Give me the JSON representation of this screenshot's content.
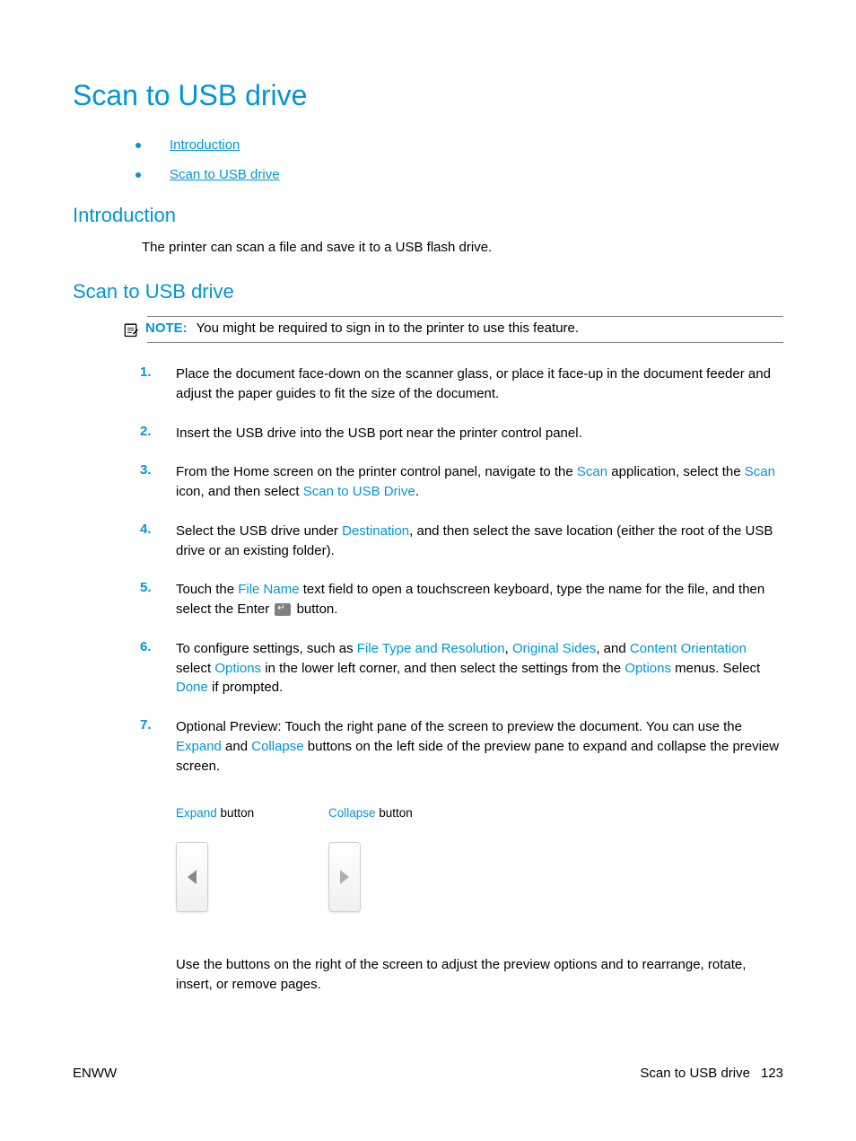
{
  "page_title": "Scan to USB drive",
  "toc": [
    {
      "label": "Introduction"
    },
    {
      "label": "Scan to USB drive"
    }
  ],
  "sections": {
    "intro": {
      "heading": "Introduction",
      "text": "The printer can scan a file and save it to a USB flash drive."
    },
    "scan": {
      "heading": "Scan to USB drive"
    }
  },
  "note": {
    "label": "NOTE:",
    "text": "You might be required to sign in to the printer to use this feature."
  },
  "steps": {
    "s1": {
      "num": "1.",
      "t1": "Place the document face-down on the scanner glass, or place it face-up in the document feeder and adjust the paper guides to fit the size of the document."
    },
    "s2": {
      "num": "2.",
      "t1": "Insert the USB drive into the USB port near the printer control panel."
    },
    "s3": {
      "num": "3.",
      "t1": "From the Home screen on the printer control panel, navigate to the ",
      "u1": "Scan",
      "t2": " application, select the ",
      "u2": "Scan",
      "t3": " icon, and then select ",
      "u3": "Scan to USB Drive",
      "t4": "."
    },
    "s4": {
      "num": "4.",
      "t1": "Select the USB drive under ",
      "u1": "Destination",
      "t2": ", and then select the save location (either the root of the USB drive or an existing folder)."
    },
    "s5": {
      "num": "5.",
      "t1": "Touch the ",
      "u1": "File Name",
      "t2": " text field to open a touchscreen keyboard, type the name for the file, and then select the Enter ",
      "t3": " button."
    },
    "s6": {
      "num": "6.",
      "t1": "To configure settings, such as ",
      "u1": "File Type and Resolution",
      "t2": ", ",
      "u2": "Original Sides",
      "t3": ", and ",
      "u3": "Content Orientation",
      "t4": " select ",
      "u4": "Options",
      "t5": " in the lower left corner, and then select the settings from the ",
      "u5": "Options",
      "t6": " menus. Select ",
      "u6": "Done",
      "t7": " if prompted."
    },
    "s7": {
      "num": "7.",
      "t1": "Optional Preview: Touch the right pane of the screen to preview the document. You can use the ",
      "u1": "Expand",
      "t2": " and ",
      "u2": "Collapse",
      "t3": " buttons on the left side of the preview pane to expand and collapse the preview screen."
    }
  },
  "button_table": {
    "expand": {
      "label": "Expand",
      "suffix": " button"
    },
    "collapse": {
      "label": "Collapse",
      "suffix": " button"
    }
  },
  "post_table_text": "Use the buttons on the right of the screen to adjust the preview options and to rearrange, rotate, insert, or remove pages.",
  "footer": {
    "left": "ENWW",
    "right_label": "Scan to USB drive",
    "page_num": "123"
  }
}
